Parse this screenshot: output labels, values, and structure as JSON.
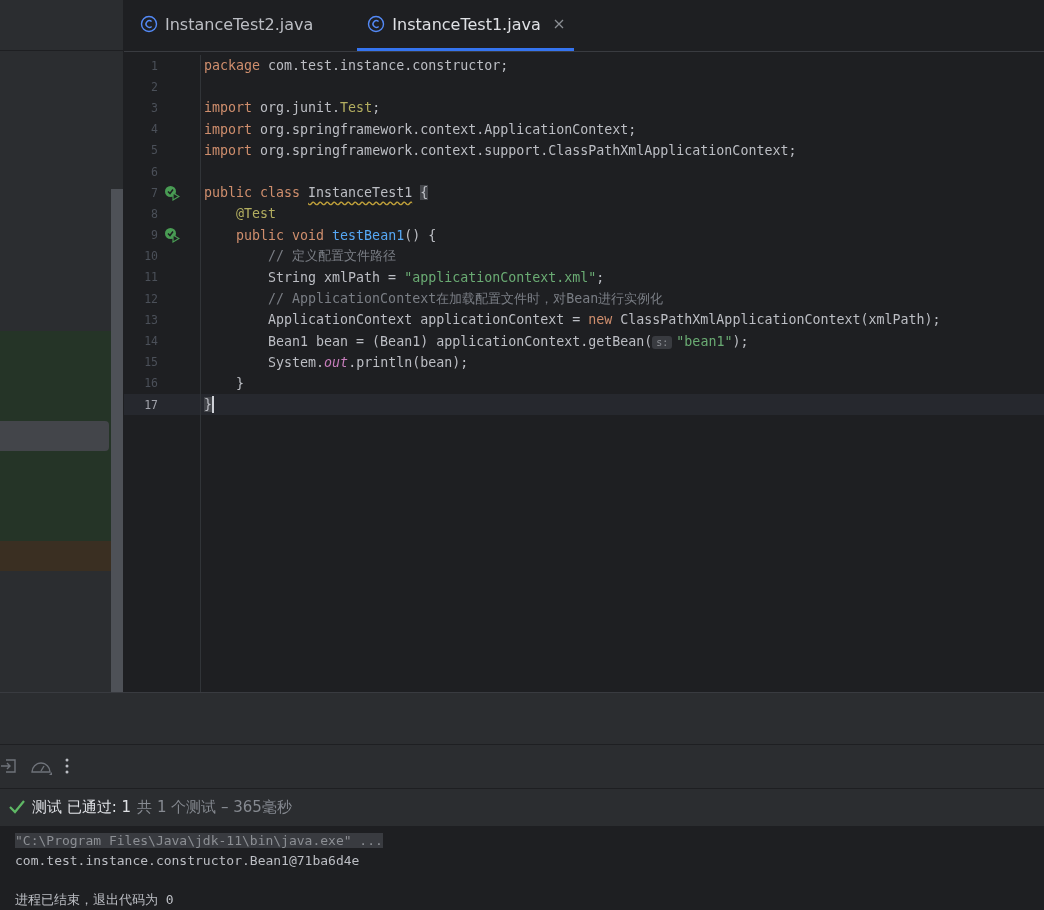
{
  "tabs": [
    {
      "label": "InstanceTest2.java",
      "selected": false
    },
    {
      "label": "InstanceTest1.java",
      "selected": true
    }
  ],
  "editor": {
    "lines": [
      {
        "number": "1",
        "tokens": [
          {
            "kind": "keyword",
            "text": "package"
          },
          {
            "kind": "plain",
            "text": " com.test.instance.constructor;"
          }
        ]
      },
      {
        "number": "2"
      },
      {
        "number": "3",
        "tokens": [
          {
            "kind": "keyword",
            "text": "import"
          },
          {
            "kind": "plain",
            "text": " org.junit."
          },
          {
            "kind": "annotation",
            "text": "Test"
          },
          {
            "kind": "plain",
            "text": ";"
          }
        ]
      },
      {
        "number": "4",
        "tokens": [
          {
            "kind": "keyword",
            "text": "import"
          },
          {
            "kind": "plain",
            "text": " org.springframework.context.ApplicationContext;"
          }
        ]
      },
      {
        "number": "5",
        "tokens": [
          {
            "kind": "keyword",
            "text": "import"
          },
          {
            "kind": "plain",
            "text": " org.springframework.context.support.ClassPathXmlApplicationContext;"
          }
        ]
      },
      {
        "number": "6"
      },
      {
        "number": "7",
        "run": true,
        "tokens": [
          {
            "kind": "keyword",
            "text": "public class "
          },
          {
            "kind": "warning",
            "text": "InstanceTest1"
          },
          {
            "kind": "brace",
            "text": "{"
          }
        ]
      },
      {
        "number": "8",
        "tokens": [
          {
            "kind": "annotation",
            "text": "    @Test"
          }
        ]
      },
      {
        "number": "9",
        "run": true,
        "tokens": [
          {
            "kind": "keyword",
            "text": "    public void "
          },
          {
            "kind": "method",
            "text": "testBean1"
          },
          {
            "kind": "plain",
            "text": "() {"
          }
        ]
      },
      {
        "number": "10",
        "tokens": [
          {
            "kind": "comment",
            "text": "        // 定义配置文件路径"
          }
        ]
      },
      {
        "number": "11",
        "tokens": [
          {
            "kind": "plain",
            "text": "        String xmlPath = "
          },
          {
            "kind": "string",
            "text": "\"applicationContext.xml\""
          },
          {
            "kind": "plain",
            "text": ";"
          }
        ]
      },
      {
        "number": "12",
        "tokens": [
          {
            "kind": "comment",
            "text": "        // ApplicationContext在加载配置文件时，对Bean进行实例化"
          }
        ]
      },
      {
        "number": "13",
        "tokens": [
          {
            "kind": "plain",
            "text": "        ApplicationContext applicationContext = "
          },
          {
            "kind": "keyword",
            "text": "new"
          },
          {
            "kind": "plain",
            "text": " ClassPathXmlApplicationContext(xmlPath);"
          }
        ]
      },
      {
        "number": "14",
        "tokens": [
          {
            "kind": "plain",
            "text": "        Bean1 bean = (Bean1) applicationContext.getBean("
          },
          {
            "kind": "hint",
            "text": "s:"
          },
          {
            "kind": "string",
            "text": "\"bean1\""
          },
          {
            "kind": "plain",
            "text": ");"
          }
        ]
      },
      {
        "number": "15",
        "tokens": [
          {
            "kind": "plain",
            "text": "        System."
          },
          {
            "kind": "field",
            "text": "out"
          },
          {
            "kind": "plain",
            "text": ".println(bean);"
          }
        ]
      },
      {
        "number": "16",
        "tokens": [
          {
            "kind": "plain",
            "text": "    }"
          }
        ]
      },
      {
        "number": "17",
        "current": true,
        "tokens": [
          {
            "kind": "brace",
            "text": "}"
          }
        ]
      }
    ]
  },
  "test_status": {
    "passed": true,
    "label": "测试 已通过: 1",
    "summary": "共 1 个测试 – 365毫秒"
  },
  "console": [
    {
      "kind": "command",
      "text": "\"C:\\Program Files\\Java\\jdk-11\\bin\\java.exe\" ..."
    },
    {
      "kind": "output",
      "text": "com.test.instance.constructor.Bean1@71ba6d4e"
    },
    {
      "kind": "blank"
    },
    {
      "kind": "output",
      "text": "进程已结束，退出代码为 0"
    }
  ]
}
